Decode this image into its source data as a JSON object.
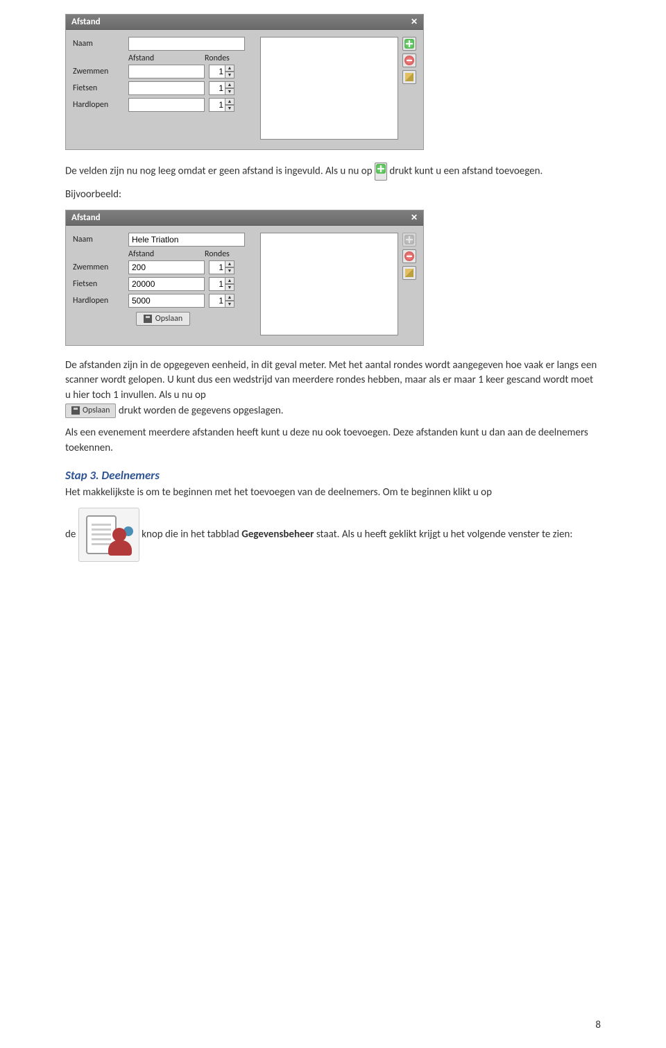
{
  "dialog1": {
    "title": "Afstand",
    "labels": {
      "naam": "Naam",
      "afstand": "Afstand",
      "rondes": "Rondes",
      "zwemmen": "Zwemmen",
      "fietsen": "Fietsen",
      "hardlopen": "Hardlopen"
    },
    "values": {
      "naam": "",
      "zwemmen": "",
      "fietsen": "",
      "hardlopen": "",
      "r1": "1",
      "r2": "1",
      "r3": "1"
    }
  },
  "dialog2": {
    "title": "Afstand",
    "labels": {
      "naam": "Naam",
      "afstand": "Afstand",
      "rondes": "Rondes",
      "zwemmen": "Zwemmen",
      "fietsen": "Fietsen",
      "hardlopen": "Hardlopen"
    },
    "values": {
      "naam": "Hele Triatlon",
      "zwemmen": "200",
      "fietsen": "20000",
      "hardlopen": "5000",
      "r1": "1",
      "r2": "1",
      "r3": "1"
    },
    "save_label": "Opslaan"
  },
  "text": {
    "p1a": "De velden zijn nu nog leeg omdat er geen afstand is ingevuld. Als u nu op ",
    "p1b": " drukt kunt u een afstand toevoegen.",
    "bijv": "Bijvoorbeeld:",
    "p2": "De afstanden zijn in de  opgegeven eenheid, in dit geval meter. Met het aantal rondes wordt aangegeven hoe vaak er langs een scanner wordt gelopen. U kunt dus een wedstrijd van meerdere rondes hebben, maar als er maar 1 keer gescand wordt moet u hier toch 1 invullen. Als u nu op ",
    "p2b": " drukt worden de gegevens opgeslagen.",
    "p3": "Als een evenement meerdere afstanden heeft kunt u deze nu ook toevoegen. Deze afstanden kunt u dan aan de deelnemers toekennen.",
    "step3": "Stap 3. Deelnemers",
    "p4": "Het makkelijkste is om te beginnen met het toevoegen van de deelnemers. Om te beginnen klikt u op",
    "p5a": "de ",
    "p5b": " knop die in het tabblad ",
    "p5bold": "Gegevensbeheer",
    "p5c": " staat. Als u heeft geklikt krijgt u het volgende venster te zien:",
    "inline_save": "Opslaan"
  },
  "pagenum": "8"
}
